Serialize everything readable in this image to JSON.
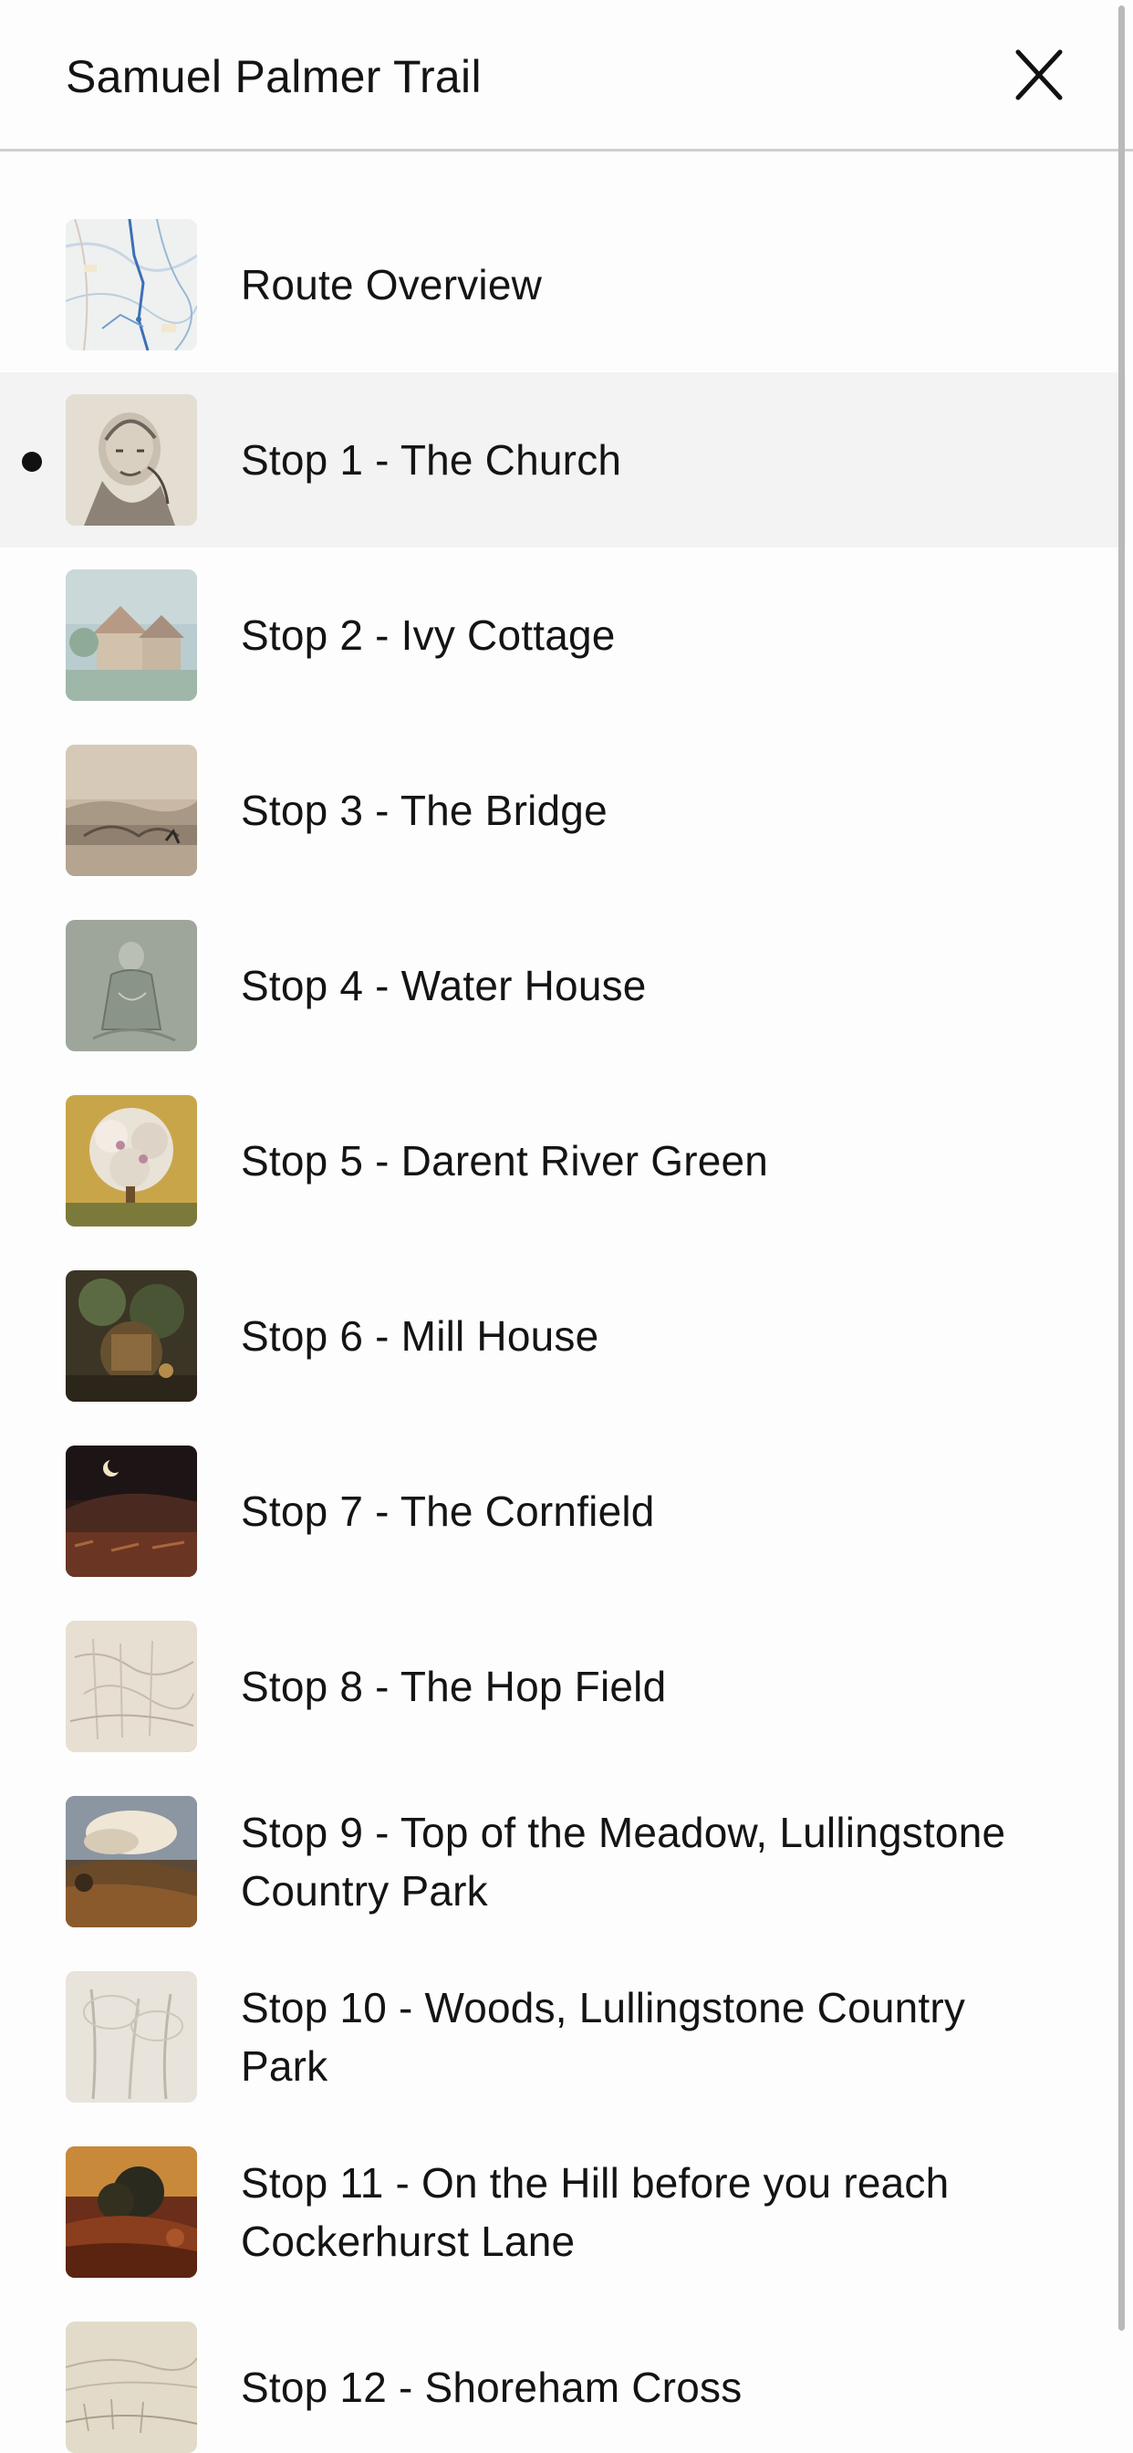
{
  "header": {
    "title": "Samuel Palmer Trail"
  },
  "icons": {
    "close": "close-icon",
    "current": "current-stop-bullet"
  },
  "list": {
    "active_index": 1,
    "items": [
      {
        "label": "Route Overview",
        "thumb": "map-thumbnail"
      },
      {
        "label": "Stop 1 - The Church",
        "thumb": "portrait-sketch-thumbnail"
      },
      {
        "label": "Stop 2 - Ivy Cottage",
        "thumb": "cottage-watercolour-thumbnail"
      },
      {
        "label": "Stop 3 - The Bridge",
        "thumb": "bridge-landscape-thumbnail"
      },
      {
        "label": "Stop 4 - Water House",
        "thumb": "seated-figure-thumbnail"
      },
      {
        "label": "Stop 5 - Darent River Green",
        "thumb": "blossom-tree-thumbnail"
      },
      {
        "label": "Stop 6 - Mill House",
        "thumb": "mill-painting-thumbnail"
      },
      {
        "label": "Stop 7 - The Cornfield",
        "thumb": "moonlit-cornfield-thumbnail"
      },
      {
        "label": "Stop 8 - The Hop Field",
        "thumb": "hop-field-sketch-thumbnail"
      },
      {
        "label": "Stop 9 - Top of the Meadow, Lullingstone Country Park",
        "thumb": "meadow-painting-thumbnail"
      },
      {
        "label": "Stop 10 - Woods, Lullingstone Country Park",
        "thumb": "woods-sketch-thumbnail"
      },
      {
        "label": "Stop 11 - On the Hill before you reach Cockerhurst Lane",
        "thumb": "hill-painting-thumbnail"
      },
      {
        "label": "Stop 12 - Shoreham Cross",
        "thumb": "shoreham-sketch-thumbnail"
      }
    ]
  },
  "colors": {
    "background": "#fdfdfd",
    "active_row": "#f3f3f3",
    "text": "#141414",
    "divider": "#cfcfcf",
    "scrollbar": "#b9b9b9"
  }
}
